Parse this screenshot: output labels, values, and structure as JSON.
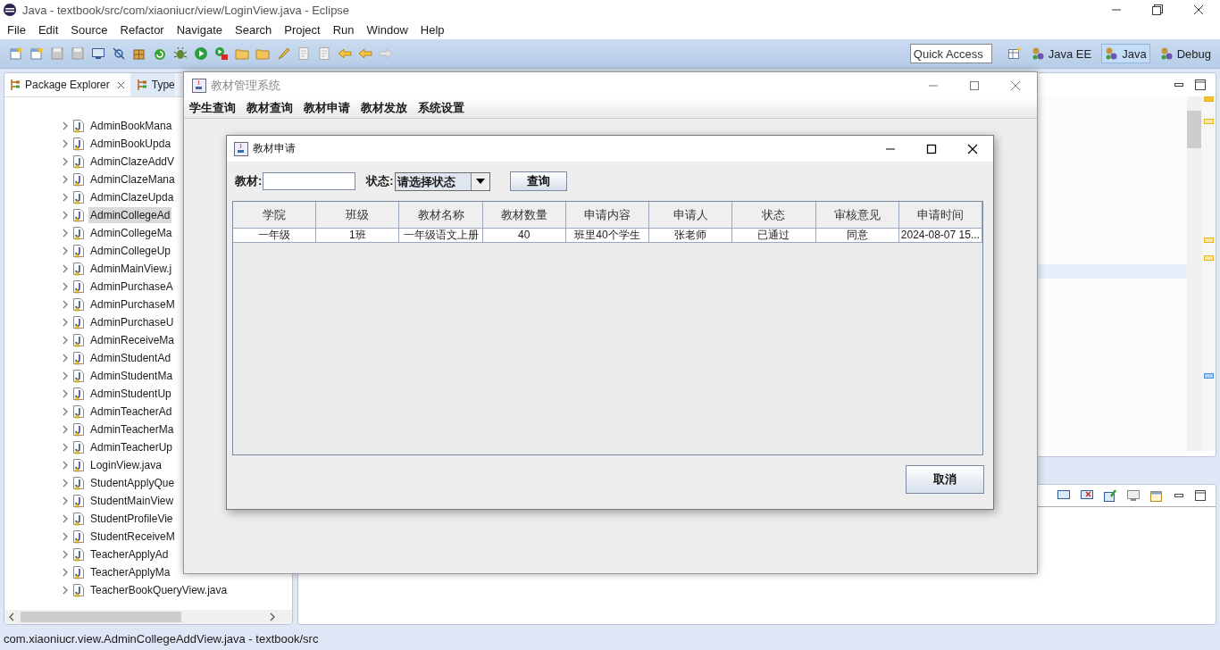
{
  "window": {
    "title": "Java - textbook/src/com/xiaoniucr/view/LoginView.java - Eclipse"
  },
  "menu": [
    "File",
    "Edit",
    "Source",
    "Refactor",
    "Navigate",
    "Search",
    "Project",
    "Run",
    "Window",
    "Help"
  ],
  "quick_access": {
    "placeholder": "Quick Access"
  },
  "perspectives": [
    {
      "label": "Java EE",
      "selected": false
    },
    {
      "label": "Java",
      "selected": true
    },
    {
      "label": "Debug",
      "selected": false
    }
  ],
  "package_explorer": {
    "tabs": [
      {
        "label": "Package Explorer",
        "selected": true
      },
      {
        "label": "Type",
        "selected": false
      }
    ],
    "items": [
      {
        "label": "AdminBookMana",
        "selected": false
      },
      {
        "label": "AdminBookUpda",
        "selected": false
      },
      {
        "label": "AdminClazeAddV",
        "selected": false
      },
      {
        "label": "AdminClazeMana",
        "selected": false
      },
      {
        "label": "AdminClazeUpda",
        "selected": false
      },
      {
        "label": "AdminCollegeAd",
        "selected": true
      },
      {
        "label": "AdminCollegeMa",
        "selected": false
      },
      {
        "label": "AdminCollegeUp",
        "selected": false
      },
      {
        "label": "AdminMainView.j",
        "selected": false
      },
      {
        "label": "AdminPurchaseA",
        "selected": false
      },
      {
        "label": "AdminPurchaseM",
        "selected": false
      },
      {
        "label": "AdminPurchaseU",
        "selected": false
      },
      {
        "label": "AdminReceiveMa",
        "selected": false
      },
      {
        "label": "AdminStudentAd",
        "selected": false
      },
      {
        "label": "AdminStudentMa",
        "selected": false
      },
      {
        "label": "AdminStudentUp",
        "selected": false
      },
      {
        "label": "AdminTeacherAd",
        "selected": false
      },
      {
        "label": "AdminTeacherMa",
        "selected": false
      },
      {
        "label": "AdminTeacherUp",
        "selected": false
      },
      {
        "label": "LoginView.java",
        "selected": false
      },
      {
        "label": "StudentApplyQue",
        "selected": false
      },
      {
        "label": "StudentMainView",
        "selected": false
      },
      {
        "label": "StudentProfileVie",
        "selected": false
      },
      {
        "label": "StudentReceiveM",
        "selected": false
      },
      {
        "label": "TeacherApplyAd",
        "selected": false
      },
      {
        "label": "TeacherApplyMa",
        "selected": false
      },
      {
        "label": "TeacherBookQueryView.java",
        "selected": false
      }
    ]
  },
  "status_bar": "com.xiaoniucr.view.AdminCollegeAddView.java - textbook/src",
  "app_window": {
    "title": "教材管理系统",
    "menu": [
      "学生查询",
      "教材查询",
      "教材申请",
      "教材发放",
      "系统设置"
    ]
  },
  "dialog": {
    "title": "教材申请",
    "book_label": "教材:",
    "status_label": "状态:",
    "status_value": "请选择状态",
    "query_button": "查询",
    "columns": [
      "学院",
      "班级",
      "教材名称",
      "教材数量",
      "申请内容",
      "申请人",
      "状态",
      "审核意见",
      "申请时间"
    ],
    "rows": [
      [
        "一年级",
        "1班",
        "一年级语文上册",
        "40",
        "班里40个学生",
        "张老师",
        "已通过",
        "同意",
        "2024-08-07 15..."
      ]
    ],
    "cancel_button": "取消"
  }
}
